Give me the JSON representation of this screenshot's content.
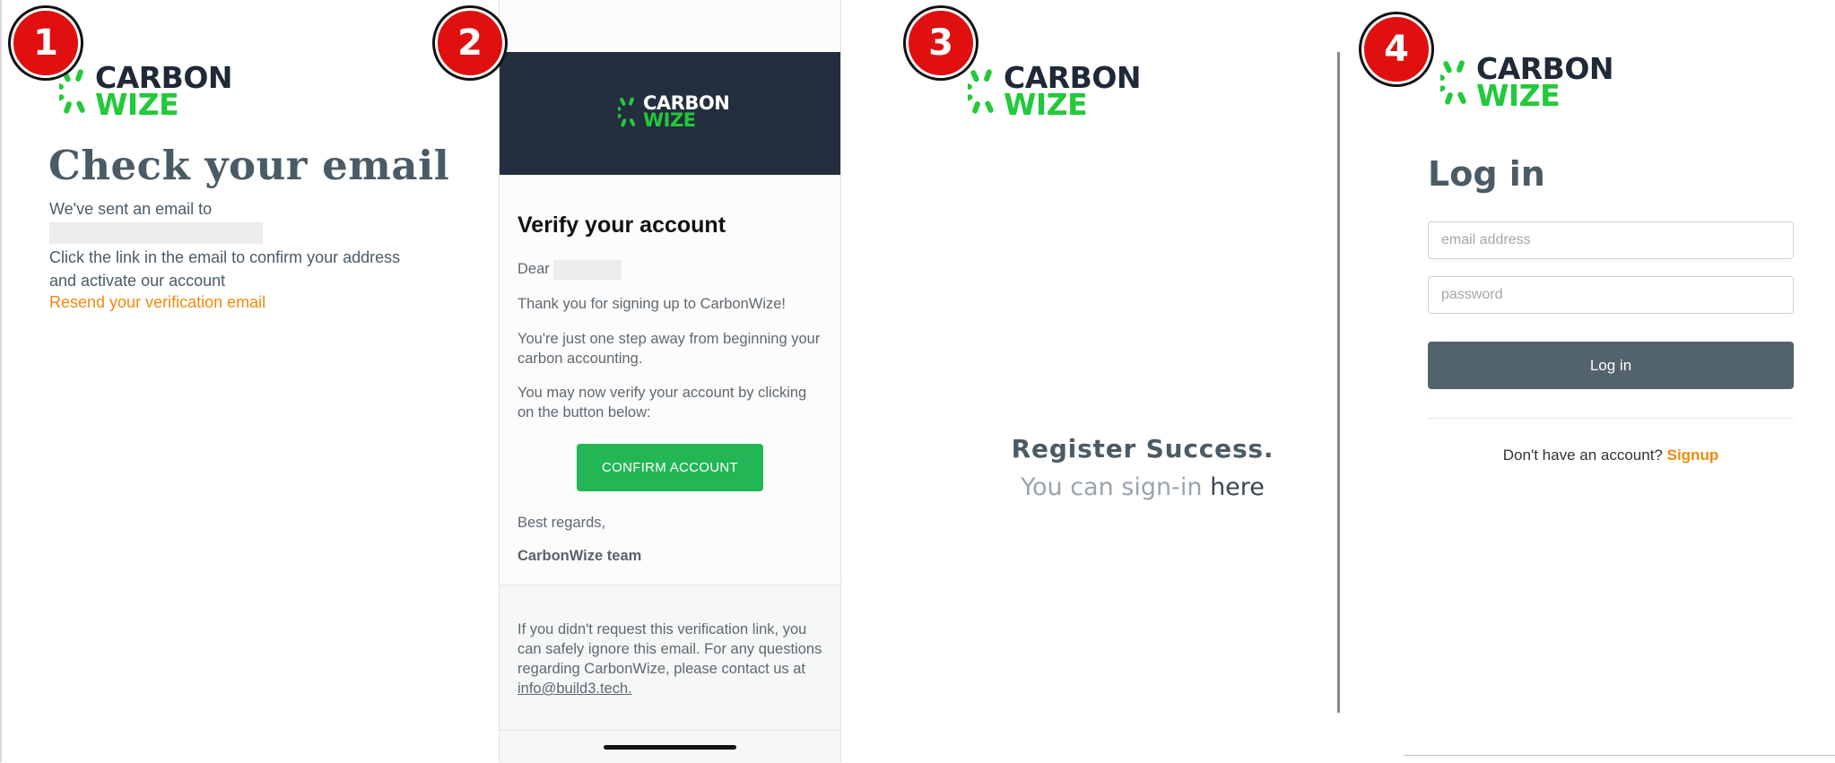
{
  "brand": {
    "line1": "CARBON",
    "line2": "WIZE",
    "dark_color": "#1f2937",
    "green_color": "#22c93a",
    "icon": "sunburst-icon"
  },
  "badges": [
    "1",
    "2",
    "3",
    "4"
  ],
  "panel1": {
    "title": "Check your email",
    "sent_text": "We've sent an email to",
    "instruction_line1": "Click the link in the email to confirm your address",
    "instruction_line2": "and activate our account",
    "resend_link": "Resend your verification email",
    "link_color": "#ef8a0b"
  },
  "panel2": {
    "heading": "Verify your account",
    "dear": "Dear",
    "thanks": "Thank you for signing up to CarbonWize!",
    "one_step": "You're just one step away from beginning your carbon accounting.",
    "verify_now": "You may now verify your account by clicking on the button below:",
    "confirm_button": "CONFIRM ACCOUNT",
    "regards": "Best regards,",
    "team": "CarbonWize team",
    "footer_text": "If you didn't request this verification link, you can safely ignore this email. For any questions regarding CarbonWize, please contact us at",
    "footer_email": "info@build3.tech."
  },
  "panel3": {
    "title": "Register Success.",
    "sub_text": "You can sign-in",
    "here_link": "here"
  },
  "panel4": {
    "title": "Log in",
    "email_placeholder": "email address",
    "password_placeholder": "password",
    "login_button": "Log in",
    "no_account": "Don't have an account?",
    "signup_link": "Signup"
  }
}
